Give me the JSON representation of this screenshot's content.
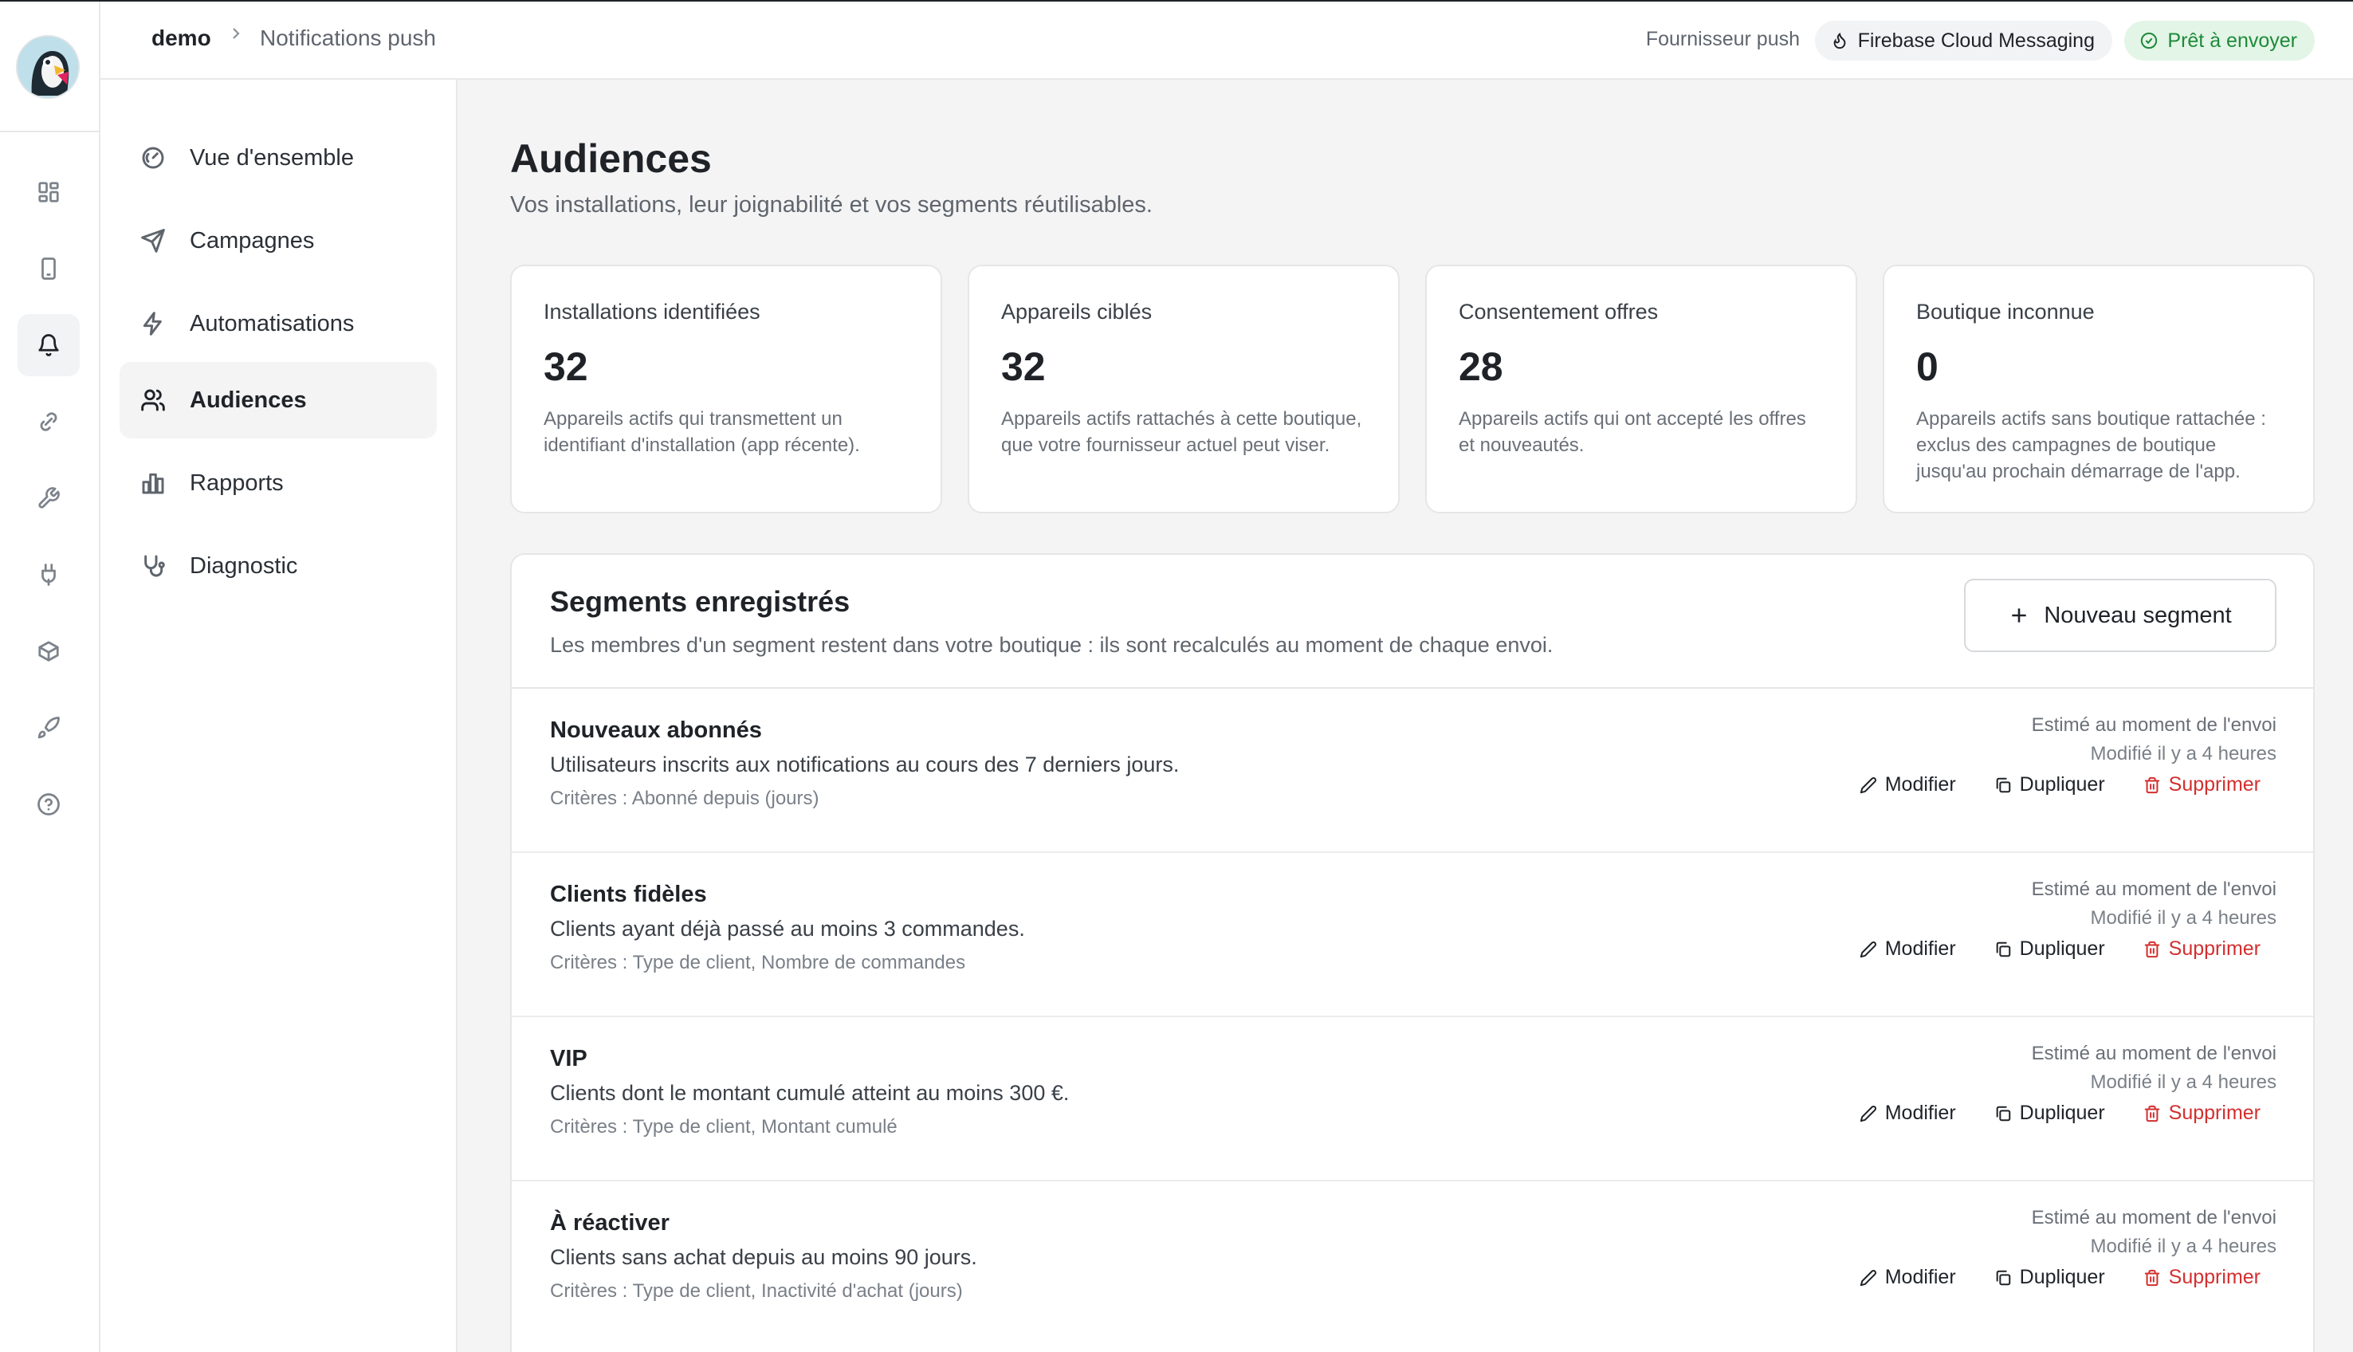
{
  "header": {
    "breadcrumb_root": "demo",
    "breadcrumb_current": "Notifications push",
    "push_provider_label": "Fournisseur push",
    "push_provider": "Firebase Cloud Messaging",
    "status": "Prêt à envoyer"
  },
  "rail": {
    "icons": [
      "dashboard-icon",
      "phone-icon",
      "bell-icon",
      "link-icon",
      "wrench-icon",
      "plug-icon",
      "package-icon",
      "rocket-icon",
      "help-icon"
    ],
    "active": "bell-icon"
  },
  "subnav": {
    "items": [
      {
        "label": "Vue d'ensemble",
        "icon": "gauge-icon"
      },
      {
        "label": "Campagnes",
        "icon": "send-icon"
      },
      {
        "label": "Automatisations",
        "icon": "bolt-icon"
      },
      {
        "label": "Audiences",
        "icon": "users-icon",
        "active": true
      },
      {
        "label": "Rapports",
        "icon": "bar-chart-icon"
      },
      {
        "label": "Diagnostic",
        "icon": "stethoscope-icon"
      }
    ]
  },
  "page": {
    "title": "Audiences",
    "subtitle": "Vos installations, leur joignabilité et vos segments réutilisables."
  },
  "stats": [
    {
      "label": "Installations identifiées",
      "value": "32",
      "desc": "Appareils actifs qui transmettent un identifiant d'installation (app récente)."
    },
    {
      "label": "Appareils ciblés",
      "value": "32",
      "desc": "Appareils actifs rattachés à cette boutique, que votre fournisseur actuel peut viser."
    },
    {
      "label": "Consentement offres",
      "value": "28",
      "desc": "Appareils actifs qui ont accepté les offres et nouveautés."
    },
    {
      "label": "Boutique inconnue",
      "value": "0",
      "desc": "Appareils actifs sans boutique rattachée : exclus des campagnes de boutique jusqu'au prochain démarrage de l'app."
    }
  ],
  "segments": {
    "title": "Segments enregistrés",
    "subtitle": "Les membres d'un segment restent dans votre boutique : ils sont recalculés au moment de chaque envoi.",
    "new_button": "Nouveau segment",
    "actions": {
      "edit": "Modifier",
      "duplicate": "Dupliquer",
      "delete": "Supprimer"
    },
    "rows": [
      {
        "name": "Nouveaux abonnés",
        "desc": "Utilisateurs inscrits aux notifications au cours des 7 derniers jours.",
        "criteria": "Critères : Abonné depuis (jours)",
        "estimate": "Estimé au moment de l'envoi",
        "modified": "Modifié il y a 4 heures"
      },
      {
        "name": "Clients fidèles",
        "desc": "Clients ayant déjà passé au moins 3 commandes.",
        "criteria": "Critères : Type de client, Nombre de commandes",
        "estimate": "Estimé au moment de l'envoi",
        "modified": "Modifié il y a 4 heures"
      },
      {
        "name": "VIP",
        "desc": "Clients dont le montant cumulé atteint au moins 300 €.",
        "criteria": "Critères : Type de client, Montant cumulé",
        "estimate": "Estimé au moment de l'envoi",
        "modified": "Modifié il y a 4 heures"
      },
      {
        "name": "À réactiver",
        "desc": "Clients sans achat depuis au moins 90 jours.",
        "criteria": "Critères : Type de client, Inactivité d'achat (jours)",
        "estimate": "Estimé au moment de l'envoi",
        "modified": "Modifié il y a 4 heures"
      }
    ]
  },
  "colors": {
    "accent_green": "#1d8a3a",
    "danger": "#d32f2f",
    "background": "#f4f4f5"
  }
}
